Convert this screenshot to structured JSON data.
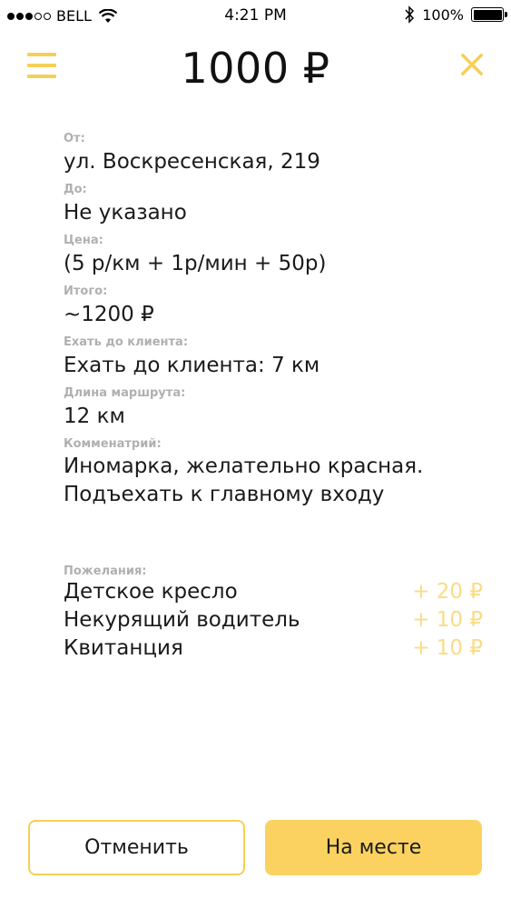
{
  "status_bar": {
    "carrier": "BELL",
    "time": "4:21 PM",
    "battery": "100%"
  },
  "header": {
    "price": "1000 ₽"
  },
  "details": [
    {
      "label": "От:",
      "value": "ул. Воскресенская, 219"
    },
    {
      "label": "До:",
      "value": "Не указано"
    },
    {
      "label": "Цена:",
      "value": "(5 р/км + 1р/мин + 50р)"
    },
    {
      "label": "Итого:",
      "value": "~1200 ₽"
    },
    {
      "label": "Ехать до клиента:",
      "value": "Ехать до клиента: 7 км"
    },
    {
      "label": "Длина маршрута:",
      "value": "12 км"
    },
    {
      "label": "Комменатрий:",
      "value_lines": [
        "Иномарка, желательно красная.",
        "Подъехать к главному входу"
      ]
    }
  ],
  "wishes": {
    "label": "Пожелания:",
    "items": [
      {
        "name": "Детское кресло",
        "price": "+ 20 ₽"
      },
      {
        "name": "Некурящий водитель",
        "price": "+ 10 ₽"
      },
      {
        "name": "Квитанция",
        "price": "+ 10 ₽"
      }
    ]
  },
  "actions": {
    "cancel_label": "Отменить",
    "arrived_label": "На месте"
  },
  "colors": {
    "accent": "#fbd260",
    "accent_light": "#f9dc84",
    "label_gray": "#b0b0b0"
  },
  "icons": {
    "menu": "hamburger-icon",
    "close": "close-icon",
    "wifi": "wifi-icon",
    "bluetooth": "bluetooth-icon",
    "battery": "battery-icon"
  }
}
